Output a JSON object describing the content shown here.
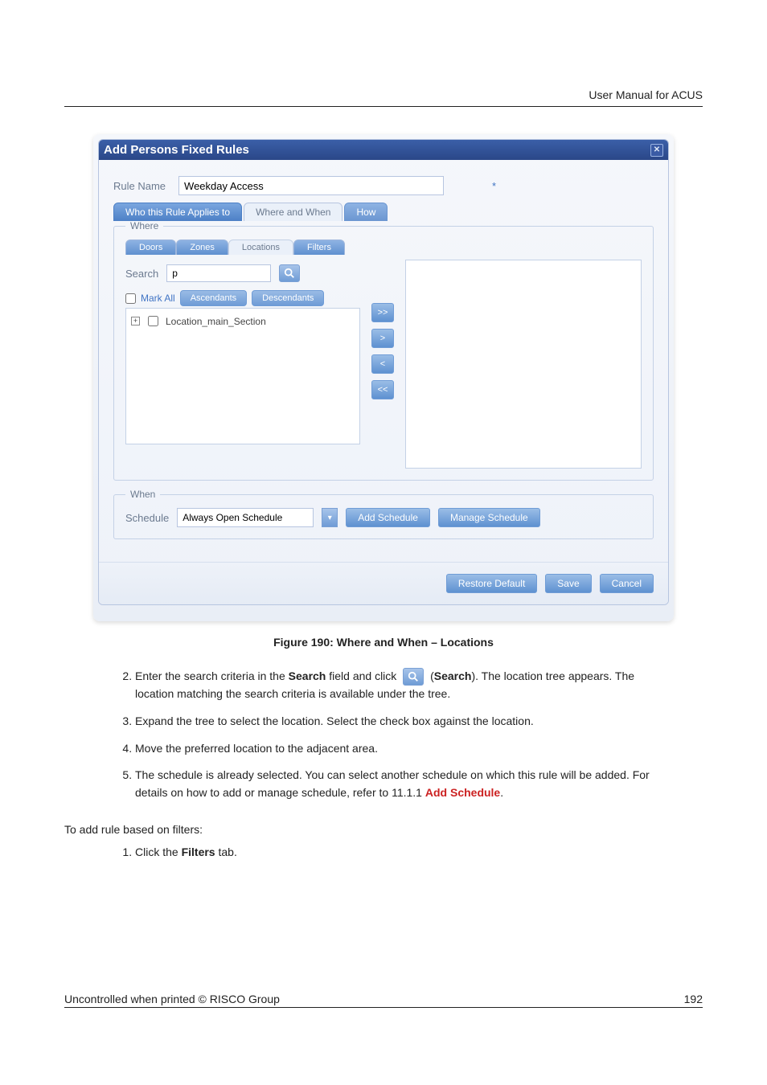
{
  "header": {
    "right_text": "User Manual for ACUS"
  },
  "dialog": {
    "title": "Add Persons Fixed Rules",
    "close_label": "✕",
    "rule": {
      "label": "Rule Name",
      "value": "Weekday Access",
      "required_mark": "*"
    },
    "outer_tabs": {
      "who": "Who this Rule Applies to",
      "where": "Where and When",
      "how": "How"
    },
    "where": {
      "legend": "Where",
      "inner_tabs": {
        "doors": "Doors",
        "zones": "Zones",
        "locations": "Locations",
        "filters": "Filters"
      },
      "search_label": "Search",
      "search_value": "p",
      "mark_all": "Mark All",
      "ascendants": "Ascendants",
      "descendants": "Descendants",
      "tree_item": "Location_main_Section",
      "move": {
        "all_right": ">>",
        "right": ">",
        "left": "<",
        "all_left": "<<"
      }
    },
    "when": {
      "legend": "When",
      "schedule_label": "Schedule",
      "schedule_value": "Always Open Schedule",
      "add": "Add Schedule",
      "manage": "Manage Schedule"
    },
    "footer": {
      "restore": "Restore Default",
      "save": "Save",
      "cancel": "Cancel"
    }
  },
  "caption": "Figure 190: Where and When – Locations",
  "steps": {
    "s2a": "Enter the search criteria in the ",
    "s2_search_bold": "Search",
    "s2b": " field and click ",
    "s2c": " (",
    "s2_search_bold2": "Search",
    "s2d": "). The location tree appears. The location matching the search criteria is available under the tree.",
    "s3": "Expand the tree to select the location. Select the check box against the location.",
    "s4": "Move the preferred location to the adjacent area.",
    "s5a": "The schedule is already selected. You can select another schedule on which this rule will be added. For details on how to add or manage schedule, refer to 11.1.1 ",
    "s5_link": "Add Schedule",
    "s5b": "."
  },
  "body2": "To add rule based on filters:",
  "steps2": {
    "s1a": "Click the ",
    "s1_bold": "Filters",
    "s1b": " tab."
  },
  "footer": {
    "left": "Uncontrolled when printed © RISCO Group",
    "right": "192"
  }
}
